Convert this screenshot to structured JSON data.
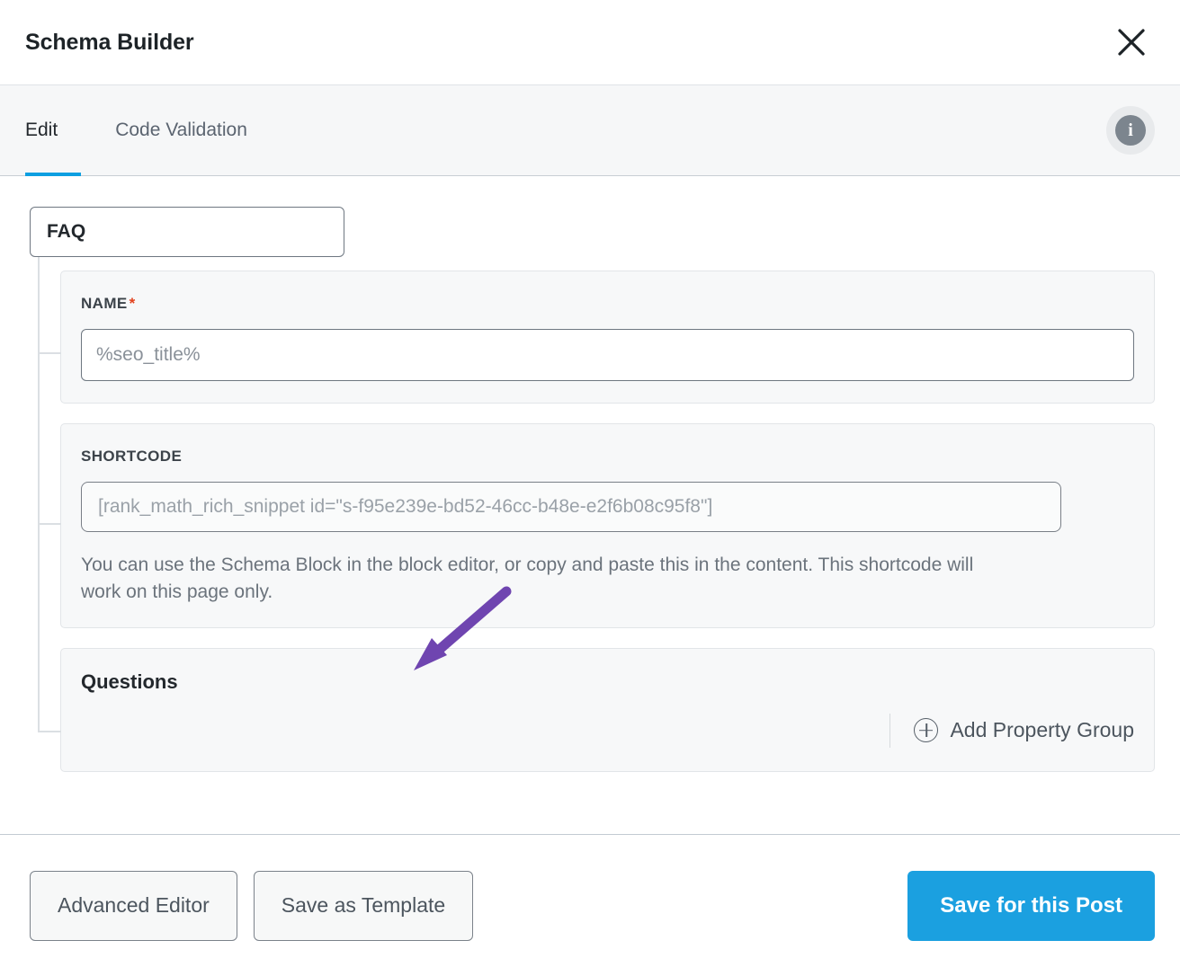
{
  "header": {
    "title": "Schema Builder",
    "close_icon": "close-icon"
  },
  "tabs": {
    "items": [
      {
        "label": "Edit",
        "active": true
      },
      {
        "label": "Code Validation",
        "active": false
      }
    ],
    "info_icon": "info-icon",
    "info_glyph": "i",
    "active_underline_color": "#0d9fe1"
  },
  "schema": {
    "type_label": "FAQ"
  },
  "name_field": {
    "label": "NAME",
    "required_marker": "*",
    "value": "%seo_title%",
    "placeholder": "%seo_title%"
  },
  "shortcode_field": {
    "label": "SHORTCODE",
    "value": "[rank_math_rich_snippet id=\"s-f95e239e-bd52-46cc-b48e-e2f6b08c95f8\"]",
    "placeholder": "[rank_math_rich_snippet id=\"s-f95e239e-bd52-46cc-b48e-e2f6b08c95f8\"]",
    "help_text": "You can use the Schema Block in the block editor, or copy and paste this in the content. This shortcode will work on this page only."
  },
  "questions_section": {
    "title": "Questions",
    "add_property_group_label": "Add Property Group",
    "add_icon": "plus-circle-icon"
  },
  "footer": {
    "advanced_editor_label": "Advanced Editor",
    "save_as_template_label": "Save as Template",
    "save_for_post_label": "Save for this Post",
    "primary_color": "#1ba0e0"
  },
  "annotation": {
    "arrow_color": "#6f45b0",
    "description": "purple arrow pointing to shortcode field"
  }
}
